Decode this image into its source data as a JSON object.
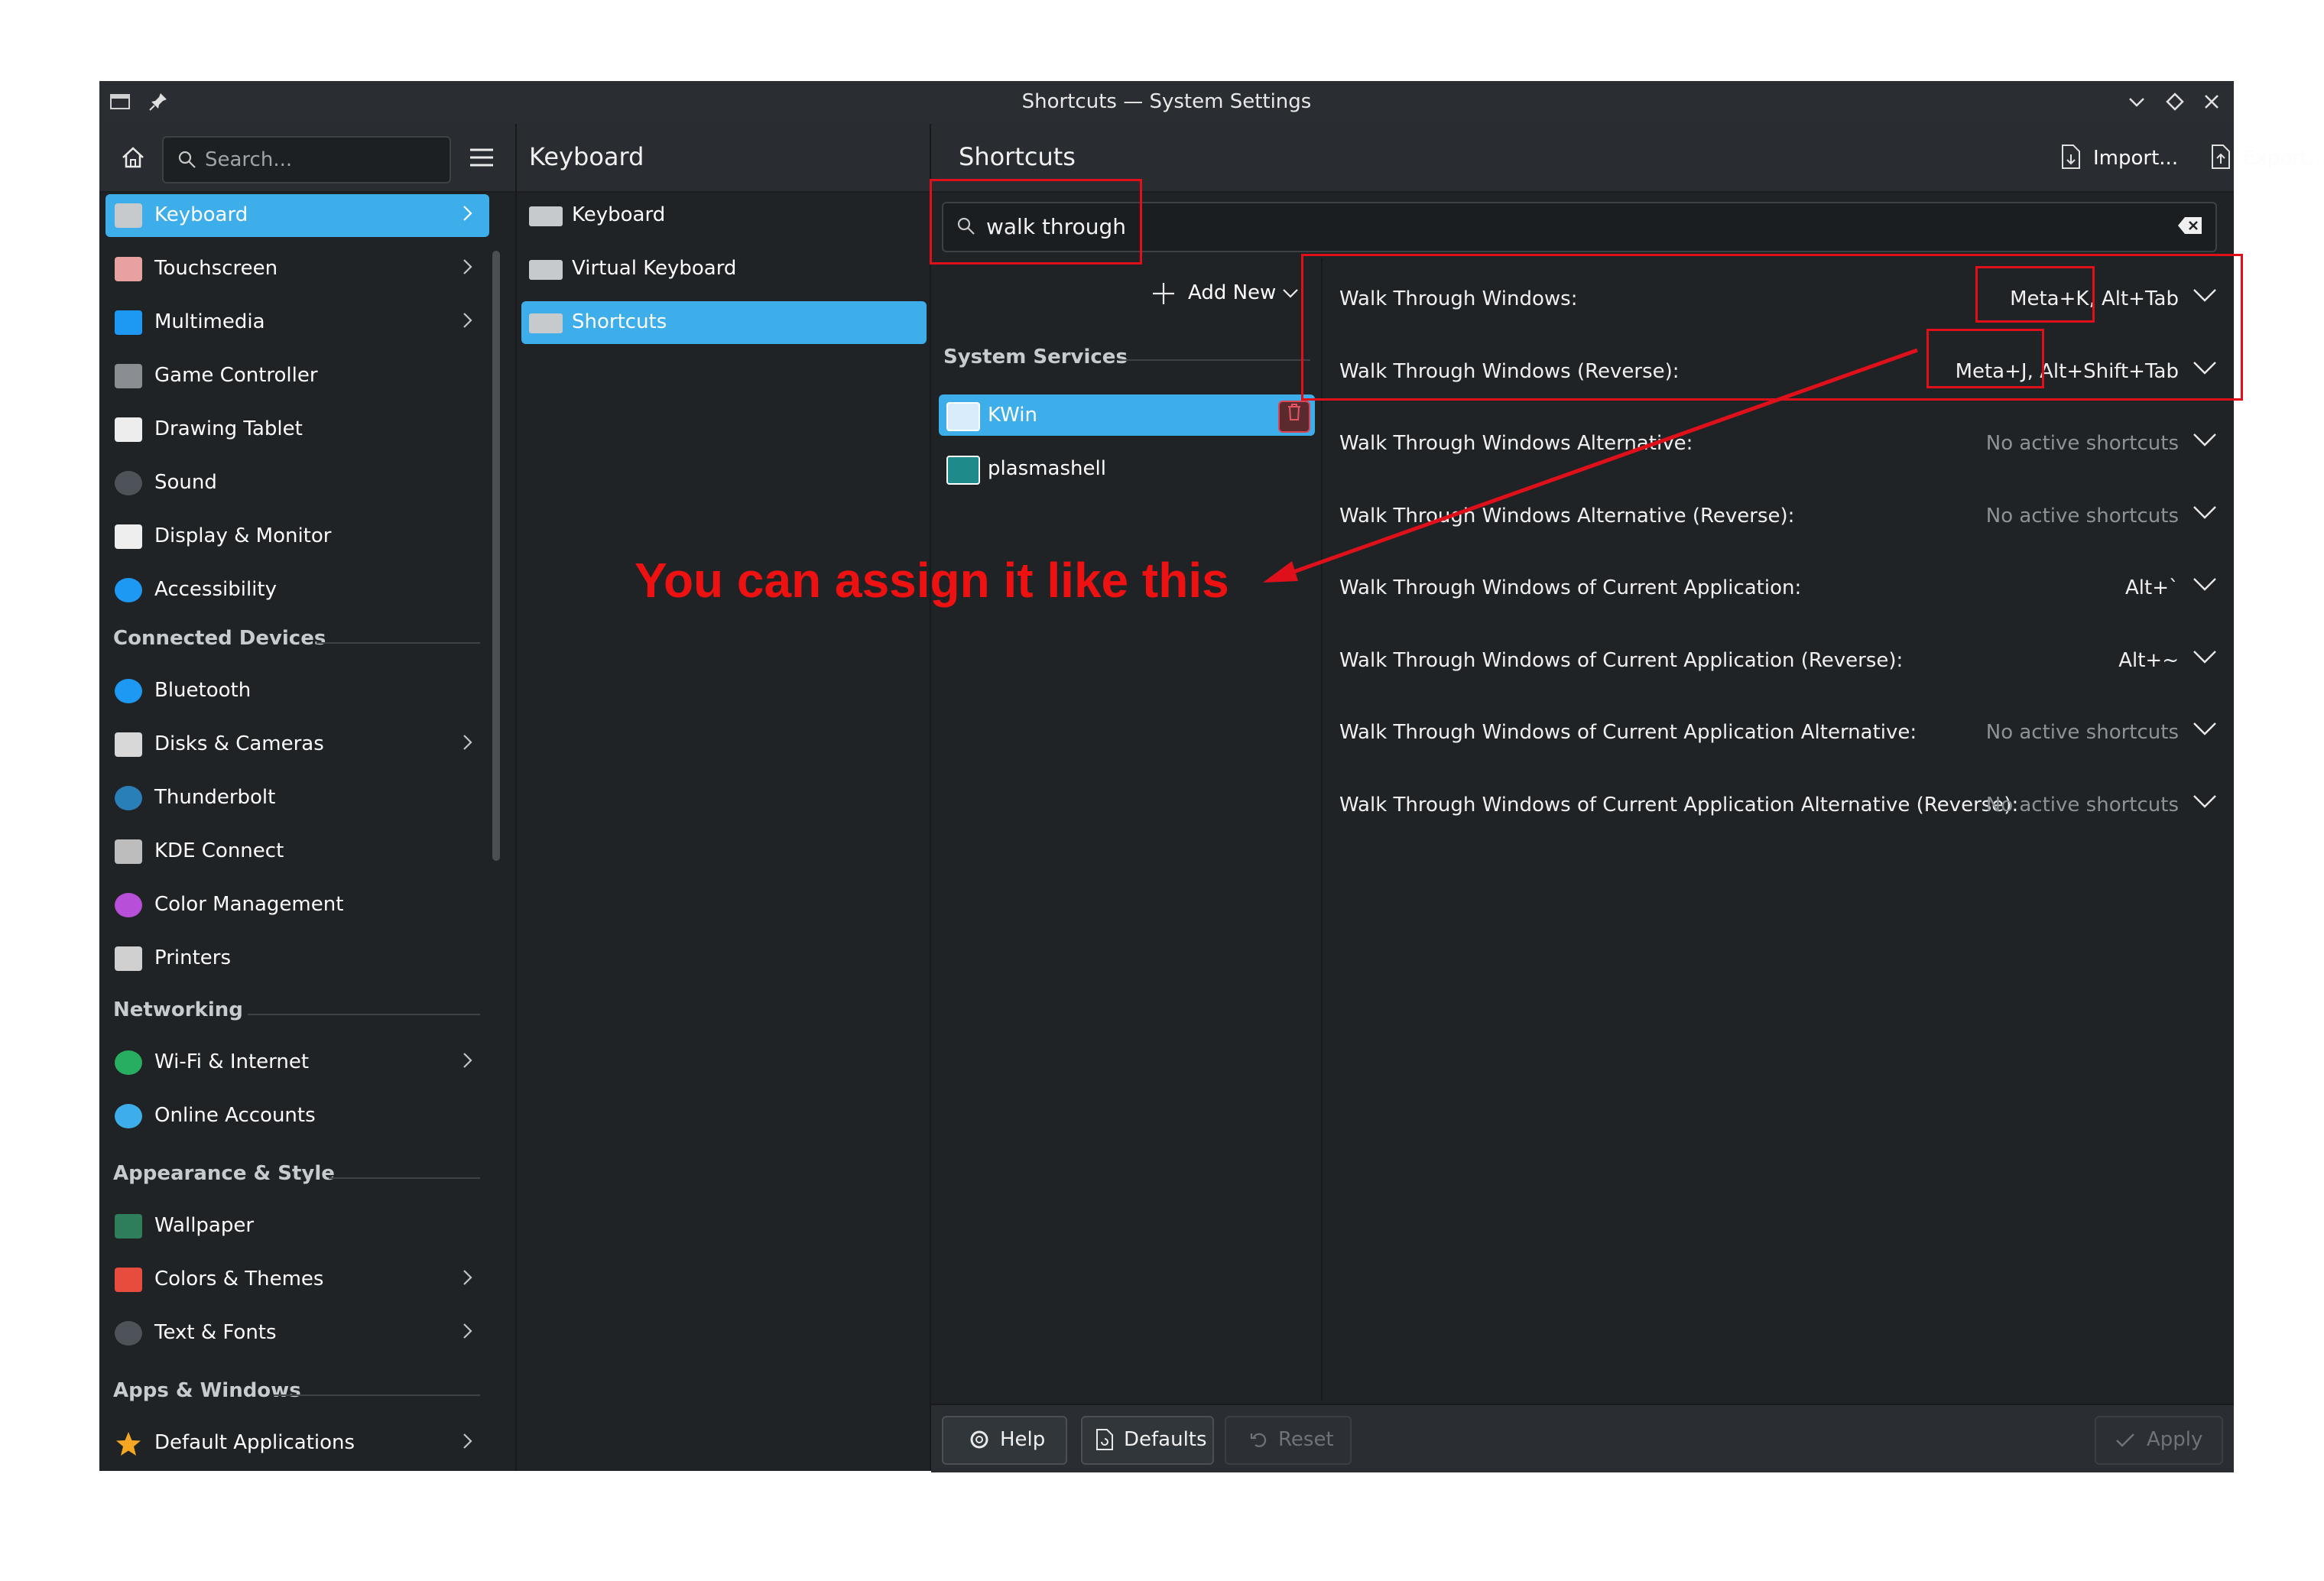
{
  "window": {
    "title": "Shortcuts — System Settings"
  },
  "toolbar": {
    "search_placeholder": "Search...",
    "col2_heading": "Keyboard",
    "col3_heading": "Shortcuts",
    "import_label": "Import...",
    "export_label": "Export..."
  },
  "sidebar": {
    "items": [
      {
        "label": "Keyboard",
        "icon": "keyboard-icon",
        "chevron": true,
        "selected": true
      },
      {
        "label": "Touchscreen",
        "icon": "touchscreen-icon",
        "chevron": true
      },
      {
        "label": "Multimedia",
        "icon": "multimedia-icon",
        "chevron": true
      },
      {
        "label": "Game Controller",
        "icon": "gamepad-icon",
        "chevron": false
      },
      {
        "label": "Drawing Tablet",
        "icon": "tablet-icon",
        "chevron": false
      },
      {
        "label": "Sound",
        "icon": "speaker-icon",
        "chevron": false
      },
      {
        "label": "Display & Monitor",
        "icon": "monitor-icon",
        "chevron": false
      },
      {
        "label": "Accessibility",
        "icon": "accessibility-icon",
        "chevron": false
      }
    ],
    "cat_connected": "Connected Devices",
    "connected_items": [
      {
        "label": "Bluetooth",
        "icon": "bluetooth-icon",
        "chevron": false
      },
      {
        "label": "Disks & Cameras",
        "icon": "disk-icon",
        "chevron": true
      },
      {
        "label": "Thunderbolt",
        "icon": "thunderbolt-icon",
        "chevron": false
      },
      {
        "label": "KDE Connect",
        "icon": "phone-icon",
        "chevron": false
      },
      {
        "label": "Color Management",
        "icon": "color-wheel-icon",
        "chevron": false
      },
      {
        "label": "Printers",
        "icon": "printer-icon",
        "chevron": false
      }
    ],
    "cat_networking": "Networking",
    "networking_items": [
      {
        "label": "Wi-Fi & Internet",
        "icon": "globe-icon",
        "chevron": true
      },
      {
        "label": "Online Accounts",
        "icon": "online-accounts-icon",
        "chevron": false
      }
    ],
    "cat_appearance": "Appearance & Style",
    "appearance_items": [
      {
        "label": "Wallpaper",
        "icon": "wallpaper-icon",
        "chevron": false
      },
      {
        "label": "Colors & Themes",
        "icon": "palette-icon",
        "chevron": true
      },
      {
        "label": "Text & Fonts",
        "icon": "font-icon",
        "chevron": true
      }
    ],
    "cat_apps": "Apps & Windows",
    "apps_items": [
      {
        "label": "Default Applications",
        "icon": "star-icon",
        "chevron": true
      }
    ]
  },
  "subpages": [
    {
      "label": "Keyboard",
      "selected": false
    },
    {
      "label": "Virtual Keyboard",
      "selected": false
    },
    {
      "label": "Shortcuts",
      "selected": true
    }
  ],
  "filter": {
    "value": "walk through"
  },
  "services": {
    "add_new_label": "Add New",
    "category": "System Services",
    "items": [
      {
        "label": "KWin",
        "selected": true
      },
      {
        "label": "plasmashell",
        "selected": false
      }
    ]
  },
  "shortcuts": [
    {
      "name": "Walk Through Windows:",
      "keys": "Meta+K, Alt+Tab",
      "active": true
    },
    {
      "name": "Walk Through Windows (Reverse):",
      "keys": "Meta+J, Alt+Shift+Tab",
      "active": true
    },
    {
      "name": "Walk Through Windows Alternative:",
      "keys": "No active shortcuts",
      "active": false
    },
    {
      "name": "Walk Through Windows Alternative (Reverse):",
      "keys": "No active shortcuts",
      "active": false
    },
    {
      "name": "Walk Through Windows of Current Application:",
      "keys": "Alt+`",
      "active": true
    },
    {
      "name": "Walk Through Windows of Current Application (Reverse):",
      "keys": "Alt+~",
      "active": true
    },
    {
      "name": "Walk Through Windows of Current Application Alternative:",
      "keys": "No active shortcuts",
      "active": false
    },
    {
      "name": "Walk Through Windows of Current Application Alternative (Reverse):",
      "keys": "No active shortcuts",
      "active": false
    }
  ],
  "footer": {
    "help_label": "Help",
    "defaults_label": "Defaults",
    "reset_label": "Reset",
    "apply_label": "Apply"
  },
  "annotation": {
    "text": "You can assign it like this",
    "color": "#e0101a"
  },
  "colors": {
    "accent": "#3daee9",
    "window_bg": "#202326",
    "danger": "#da4453"
  }
}
